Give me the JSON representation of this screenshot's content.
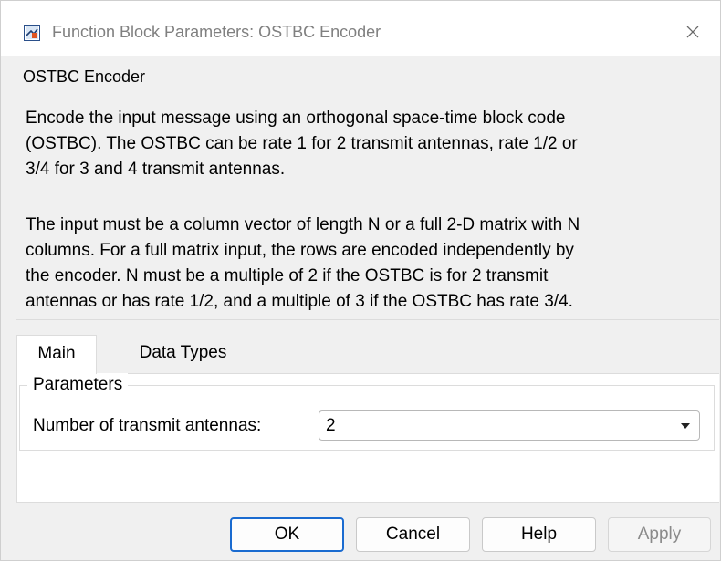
{
  "window": {
    "title": "Function Block Parameters: OSTBC Encoder",
    "close_glyph": "✕"
  },
  "block": {
    "group_title": "OSTBC Encoder",
    "description_lines_1": [
      "Encode the input message using an orthogonal space-time block code",
      "(OSTBC). The OSTBC can be rate 1 for 2 transmit antennas, rate 1/2 or",
      "3/4 for 3 and 4 transmit antennas."
    ],
    "description_lines_2": [
      "The input must be a column vector of length N or a full 2-D matrix with N",
      "columns. For a full matrix input, the rows are encoded independently by",
      "the encoder. N must be a multiple of 2 if the OSTBC is for 2 transmit",
      "antennas or has rate 1/2, and a multiple of 3 if the OSTBC has rate 3/4."
    ]
  },
  "tabs": [
    {
      "label": "Main",
      "active": true
    },
    {
      "label": "Data Types",
      "active": false
    }
  ],
  "parameters": {
    "group_title": "Parameters",
    "antennas_label": "Number of transmit antennas:",
    "antennas_value": "2"
  },
  "buttons": {
    "ok": "OK",
    "cancel": "Cancel",
    "help": "Help",
    "apply": "Apply"
  },
  "colors": {
    "accent": "#1a6bd0",
    "title_text": "#808080",
    "disabled_text": "#8a8a8a"
  },
  "icons": {
    "app": "simulink-block-icon",
    "close": "close-icon",
    "dropdown": "chevron-down-icon"
  }
}
